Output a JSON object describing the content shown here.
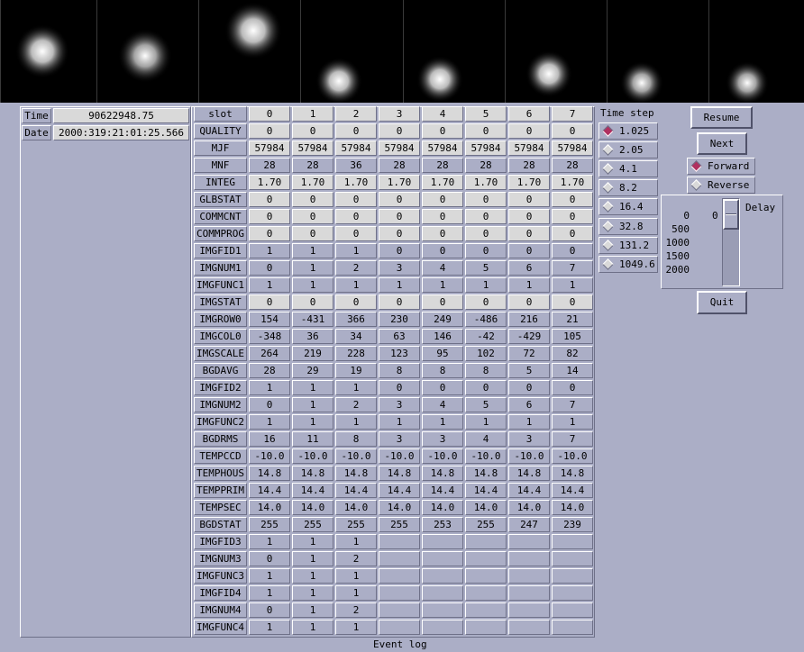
{
  "star_images": [
    {
      "slot": 0,
      "brightness": 0.95
    },
    {
      "slot": 1,
      "brightness": 0.8
    },
    {
      "slot": 2,
      "brightness": 0.95
    },
    {
      "slot": 3,
      "brightness": 0.95
    },
    {
      "slot": 4,
      "brightness": 0.9
    },
    {
      "slot": 5,
      "brightness": 0.95
    },
    {
      "slot": 6,
      "brightness": 0.85
    },
    {
      "slot": 7,
      "brightness": 0.85
    }
  ],
  "info": {
    "time_label": "Time",
    "time_value": "90622948.75",
    "date_label": "Date",
    "date_value": "2000:319:21:01:25.566"
  },
  "table": {
    "rows": [
      {
        "label": "slot",
        "values": [
          "0",
          "1",
          "2",
          "3",
          "4",
          "5",
          "6",
          "7"
        ],
        "style": "val"
      },
      {
        "label": "QUALITY",
        "values": [
          "0",
          "0",
          "0",
          "0",
          "0",
          "0",
          "0",
          "0"
        ],
        "style": "val"
      },
      {
        "label": "MJF",
        "values": [
          "57984",
          "57984",
          "57984",
          "57984",
          "57984",
          "57984",
          "57984",
          "57984"
        ],
        "style": "val"
      },
      {
        "label": "MNF",
        "values": [
          "28",
          "28",
          "36",
          "28",
          "28",
          "28",
          "28",
          "28"
        ],
        "style": "valb"
      },
      {
        "label": "INTEG",
        "values": [
          "1.70",
          "1.70",
          "1.70",
          "1.70",
          "1.70",
          "1.70",
          "1.70",
          "1.70"
        ],
        "style": "val"
      },
      {
        "label": "GLBSTAT",
        "values": [
          "0",
          "0",
          "0",
          "0",
          "0",
          "0",
          "0",
          "0"
        ],
        "style": "val"
      },
      {
        "label": "COMMCNT",
        "values": [
          "0",
          "0",
          "0",
          "0",
          "0",
          "0",
          "0",
          "0"
        ],
        "style": "val"
      },
      {
        "label": "COMMPROG",
        "values": [
          "0",
          "0",
          "0",
          "0",
          "0",
          "0",
          "0",
          "0"
        ],
        "style": "val"
      },
      {
        "label": "IMGFID1",
        "values": [
          "1",
          "1",
          "1",
          "0",
          "0",
          "0",
          "0",
          "0"
        ],
        "style": "valb"
      },
      {
        "label": "IMGNUM1",
        "values": [
          "0",
          "1",
          "2",
          "3",
          "4",
          "5",
          "6",
          "7"
        ],
        "style": "valb"
      },
      {
        "label": "IMGFUNC1",
        "values": [
          "1",
          "1",
          "1",
          "1",
          "1",
          "1",
          "1",
          "1"
        ],
        "style": "valb"
      },
      {
        "label": "IMGSTAT",
        "values": [
          "0",
          "0",
          "0",
          "0",
          "0",
          "0",
          "0",
          "0"
        ],
        "style": "val"
      },
      {
        "label": "IMGROW0",
        "values": [
          "154",
          "-431",
          "366",
          "230",
          "249",
          "-486",
          "216",
          "21"
        ],
        "style": "valb"
      },
      {
        "label": "IMGCOL0",
        "values": [
          "-348",
          "36",
          "34",
          "63",
          "146",
          "-42",
          "-429",
          "105"
        ],
        "style": "valb"
      },
      {
        "label": "IMGSCALE",
        "values": [
          "264",
          "219",
          "228",
          "123",
          "95",
          "102",
          "72",
          "82"
        ],
        "style": "valb"
      },
      {
        "label": "BGDAVG",
        "values": [
          "28",
          "29",
          "19",
          "8",
          "8",
          "8",
          "5",
          "14"
        ],
        "style": "valb"
      },
      {
        "label": "IMGFID2",
        "values": [
          "1",
          "1",
          "1",
          "0",
          "0",
          "0",
          "0",
          "0"
        ],
        "style": "valb"
      },
      {
        "label": "IMGNUM2",
        "values": [
          "0",
          "1",
          "2",
          "3",
          "4",
          "5",
          "6",
          "7"
        ],
        "style": "valb"
      },
      {
        "label": "IMGFUNC2",
        "values": [
          "1",
          "1",
          "1",
          "1",
          "1",
          "1",
          "1",
          "1"
        ],
        "style": "valb"
      },
      {
        "label": "BGDRMS",
        "values": [
          "16",
          "11",
          "8",
          "3",
          "3",
          "4",
          "3",
          "7"
        ],
        "style": "valb"
      },
      {
        "label": "TEMPCCD",
        "values": [
          "-10.0",
          "-10.0",
          "-10.0",
          "-10.0",
          "-10.0",
          "-10.0",
          "-10.0",
          "-10.0"
        ],
        "style": "valb"
      },
      {
        "label": "TEMPHOUS",
        "values": [
          "14.8",
          "14.8",
          "14.8",
          "14.8",
          "14.8",
          "14.8",
          "14.8",
          "14.8"
        ],
        "style": "valb"
      },
      {
        "label": "TEMPPRIM",
        "values": [
          "14.4",
          "14.4",
          "14.4",
          "14.4",
          "14.4",
          "14.4",
          "14.4",
          "14.4"
        ],
        "style": "valb"
      },
      {
        "label": "TEMPSEC",
        "values": [
          "14.0",
          "14.0",
          "14.0",
          "14.0",
          "14.0",
          "14.0",
          "14.0",
          "14.0"
        ],
        "style": "valb"
      },
      {
        "label": "BGDSTAT",
        "values": [
          "255",
          "255",
          "255",
          "255",
          "253",
          "255",
          "247",
          "239"
        ],
        "style": "valb"
      },
      {
        "label": "IMGFID3",
        "values": [
          "1",
          "1",
          "1",
          "",
          "",
          "",
          "",
          ""
        ],
        "style": "valb"
      },
      {
        "label": "IMGNUM3",
        "values": [
          "0",
          "1",
          "2",
          "",
          "",
          "",
          "",
          ""
        ],
        "style": "valb"
      },
      {
        "label": "IMGFUNC3",
        "values": [
          "1",
          "1",
          "1",
          "",
          "",
          "",
          "",
          ""
        ],
        "style": "valb"
      },
      {
        "label": "IMGFID4",
        "values": [
          "1",
          "1",
          "1",
          "",
          "",
          "",
          "",
          ""
        ],
        "style": "valb"
      },
      {
        "label": "IMGNUM4",
        "values": [
          "0",
          "1",
          "2",
          "",
          "",
          "",
          "",
          ""
        ],
        "style": "valb"
      },
      {
        "label": "IMGFUNC4",
        "values": [
          "1",
          "1",
          "1",
          "",
          "",
          "",
          "",
          ""
        ],
        "style": "valb"
      }
    ]
  },
  "time_step": {
    "label": "Time step",
    "options": [
      "1.025",
      "2.05",
      "4.1",
      "8.2",
      "16.4",
      "32.8",
      "131.2",
      "1049.6"
    ],
    "selected": "1.025"
  },
  "controls": {
    "resume_label": "Resume",
    "next_label": "Next",
    "forward_label": "Forward",
    "reverse_label": "Reverse",
    "direction_selected": "Forward",
    "quit_label": "Quit"
  },
  "delay": {
    "label": "Delay",
    "value": "0",
    "ticks": [
      "0",
      "500",
      "1000",
      "1500",
      "2000"
    ]
  },
  "event_log_label": "Event log",
  "colors": {
    "background": "#abaec6",
    "value_cell": "#d9d9d9",
    "radio_selected": "#b03060"
  }
}
